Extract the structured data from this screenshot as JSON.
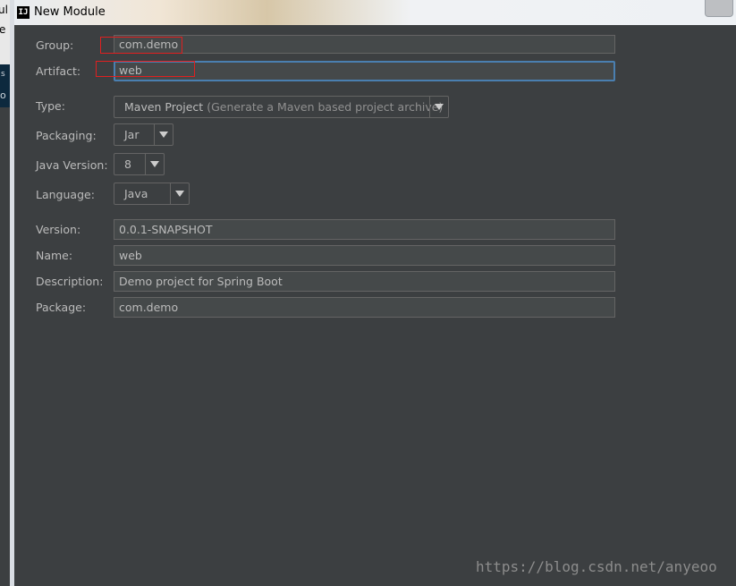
{
  "window": {
    "title": "New Module",
    "app_icon": "IJ"
  },
  "background_window": {
    "glyphs": [
      "ul",
      "e",
      "s",
      "o"
    ]
  },
  "labels": {
    "group": "Group:",
    "artifact": "Artifact:",
    "type": "Type:",
    "packaging": "Packaging:",
    "java_version": "Java Version:",
    "language": "Language:",
    "version": "Version:",
    "name": "Name:",
    "description": "Description:",
    "package": "Package:"
  },
  "values": {
    "group": "com.demo",
    "artifact": "web",
    "type_main": "Maven Project",
    "type_hint": "(Generate a Maven based project archive)",
    "packaging": "Jar",
    "java_version": "8",
    "language": "Java",
    "version": "0.0.1-SNAPSHOT",
    "name": "web",
    "description": "Demo project for Spring Boot",
    "package": "com.demo"
  },
  "watermark": "https://blog.csdn.net/anyeoo",
  "colors": {
    "background": "#3c3f41",
    "focus_border": "#4a7fb0",
    "annotation_red": "#e02020"
  }
}
